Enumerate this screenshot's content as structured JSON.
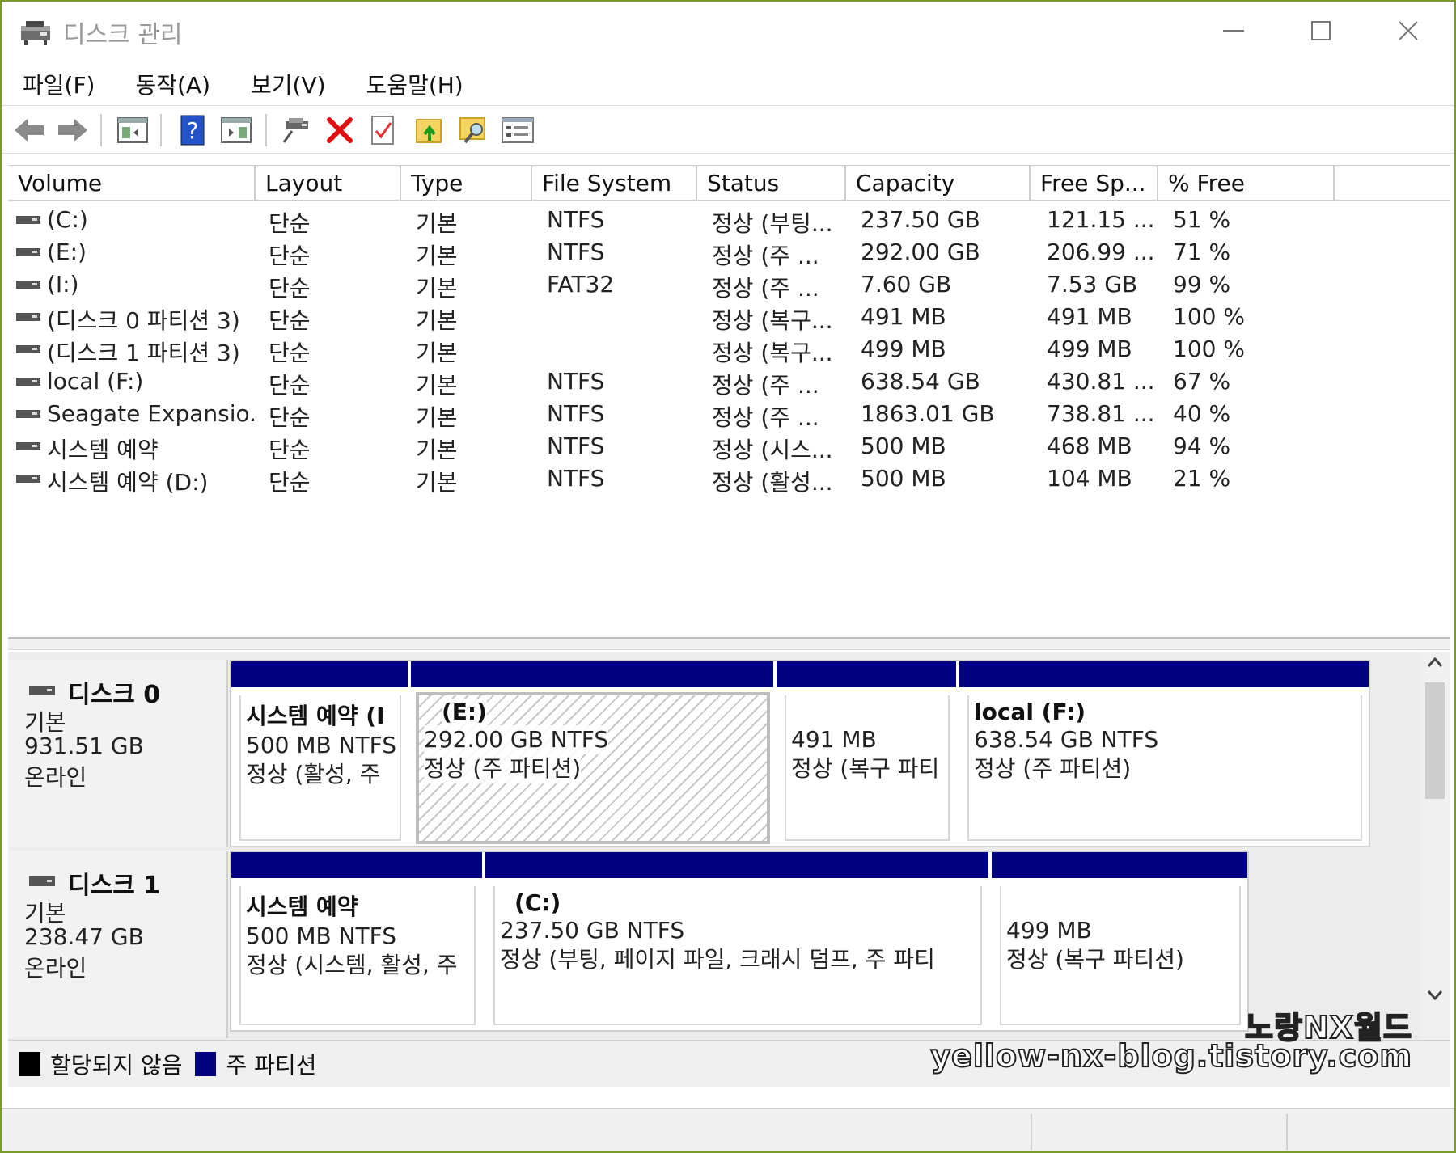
{
  "window": {
    "title": "디스크 관리"
  },
  "menu": [
    "파일(F)",
    "동작(A)",
    "보기(V)",
    "도움말(H)"
  ],
  "toolbar": [
    "back-icon",
    "forward-icon",
    "show-hide-console-tree-icon",
    "help-icon",
    "show-hide-action-pane-icon",
    "connect-drive-icon",
    "delete-icon",
    "checkmark-properties-icon",
    "folder-up-icon",
    "folder-search-icon",
    "view-list-icon"
  ],
  "columns": [
    "Volume",
    "Layout",
    "Type",
    "File System",
    "Status",
    "Capacity",
    "Free Sp...",
    "% Free"
  ],
  "volumes": [
    {
      "volume": "(C:)",
      "layout": "단순",
      "type": "기본",
      "fs": "NTFS",
      "status": "정상 (부팅...",
      "capacity": "237.50 GB",
      "free": "121.15 ...",
      "pct": "51 %"
    },
    {
      "volume": "(E:)",
      "layout": "단순",
      "type": "기본",
      "fs": "NTFS",
      "status": "정상 (주 ...",
      "capacity": "292.00 GB",
      "free": "206.99 ...",
      "pct": "71 %"
    },
    {
      "volume": "(I:)",
      "layout": "단순",
      "type": "기본",
      "fs": "FAT32",
      "status": "정상 (주 ...",
      "capacity": "7.60 GB",
      "free": "7.53 GB",
      "pct": "99 %"
    },
    {
      "volume": "(디스크 0 파티션 3)",
      "layout": "단순",
      "type": "기본",
      "fs": "",
      "status": "정상 (복구...",
      "capacity": "491 MB",
      "free": "491 MB",
      "pct": "100 %"
    },
    {
      "volume": "(디스크 1 파티션 3)",
      "layout": "단순",
      "type": "기본",
      "fs": "",
      "status": "정상 (복구...",
      "capacity": "499 MB",
      "free": "499 MB",
      "pct": "100 %"
    },
    {
      "volume": "local (F:)",
      "layout": "단순",
      "type": "기본",
      "fs": "NTFS",
      "status": "정상 (주 ...",
      "capacity": "638.54 GB",
      "free": "430.81 ...",
      "pct": "67 %"
    },
    {
      "volume": "Seagate Expansio...",
      "layout": "단순",
      "type": "기본",
      "fs": "NTFS",
      "status": "정상 (주 ...",
      "capacity": "1863.01 GB",
      "free": "738.81 ...",
      "pct": "40 %"
    },
    {
      "volume": "시스템 예약",
      "layout": "단순",
      "type": "기본",
      "fs": "NTFS",
      "status": "정상 (시스...",
      "capacity": "500 MB",
      "free": "468 MB",
      "pct": "94 %"
    },
    {
      "volume": "시스템 예약 (D:)",
      "layout": "단순",
      "type": "기본",
      "fs": "NTFS",
      "status": "정상 (활성...",
      "capacity": "500 MB",
      "free": "104 MB",
      "pct": "21 %"
    }
  ],
  "disks": [
    {
      "name": "디스크 0",
      "type": "기본",
      "size": "931.51 GB",
      "state": "온라인",
      "partitions": [
        {
          "name": "시스템 예약  (I",
          "line1": "500 MB NTFS",
          "line2": "정상 (활성, 주"
        },
        {
          "name": "(E:)",
          "line1": "292.00 GB NTFS",
          "line2": "정상 (주 파티션)"
        },
        {
          "name": "",
          "line1": "491 MB",
          "line2": "정상 (복구 파티"
        },
        {
          "name": "local  (F:)",
          "line1": "638.54 GB NTFS",
          "line2": "정상 (주 파티션)"
        }
      ]
    },
    {
      "name": "디스크 1",
      "type": "기본",
      "size": "238.47 GB",
      "state": "온라인",
      "partitions": [
        {
          "name": "시스템 예약",
          "line1": "500 MB NTFS",
          "line2": "정상 (시스템, 활성, 주"
        },
        {
          "name": "(C:)",
          "line1": "237.50 GB NTFS",
          "line2": "정상 (부팅, 페이지 파일, 크래시 덤프, 주 파티"
        },
        {
          "name": "",
          "line1": "499 MB",
          "line2": "정상 (복구 파티션)"
        }
      ]
    }
  ],
  "legend": [
    {
      "label": "할당되지 않음",
      "color": "#000000"
    },
    {
      "label": "주 파티션",
      "color": "#000080"
    }
  ],
  "watermark": {
    "line1": "노랑NX월드",
    "line2": "yellow-nx-blog.tistory.com"
  }
}
